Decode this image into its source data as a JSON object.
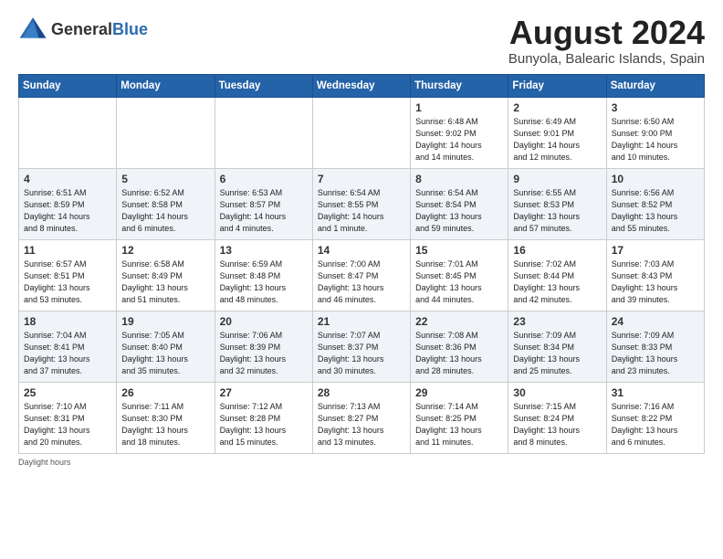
{
  "header": {
    "logo_general": "General",
    "logo_blue": "Blue",
    "month_year": "August 2024",
    "location": "Bunyola, Balearic Islands, Spain"
  },
  "columns": [
    "Sunday",
    "Monday",
    "Tuesday",
    "Wednesday",
    "Thursday",
    "Friday",
    "Saturday"
  ],
  "weeks": [
    [
      {
        "day": "",
        "info": ""
      },
      {
        "day": "",
        "info": ""
      },
      {
        "day": "",
        "info": ""
      },
      {
        "day": "",
        "info": ""
      },
      {
        "day": "1",
        "info": "Sunrise: 6:48 AM\nSunset: 9:02 PM\nDaylight: 14 hours\nand 14 minutes."
      },
      {
        "day": "2",
        "info": "Sunrise: 6:49 AM\nSunset: 9:01 PM\nDaylight: 14 hours\nand 12 minutes."
      },
      {
        "day": "3",
        "info": "Sunrise: 6:50 AM\nSunset: 9:00 PM\nDaylight: 14 hours\nand 10 minutes."
      }
    ],
    [
      {
        "day": "4",
        "info": "Sunrise: 6:51 AM\nSunset: 8:59 PM\nDaylight: 14 hours\nand 8 minutes."
      },
      {
        "day": "5",
        "info": "Sunrise: 6:52 AM\nSunset: 8:58 PM\nDaylight: 14 hours\nand 6 minutes."
      },
      {
        "day": "6",
        "info": "Sunrise: 6:53 AM\nSunset: 8:57 PM\nDaylight: 14 hours\nand 4 minutes."
      },
      {
        "day": "7",
        "info": "Sunrise: 6:54 AM\nSunset: 8:55 PM\nDaylight: 14 hours\nand 1 minute."
      },
      {
        "day": "8",
        "info": "Sunrise: 6:54 AM\nSunset: 8:54 PM\nDaylight: 13 hours\nand 59 minutes."
      },
      {
        "day": "9",
        "info": "Sunrise: 6:55 AM\nSunset: 8:53 PM\nDaylight: 13 hours\nand 57 minutes."
      },
      {
        "day": "10",
        "info": "Sunrise: 6:56 AM\nSunset: 8:52 PM\nDaylight: 13 hours\nand 55 minutes."
      }
    ],
    [
      {
        "day": "11",
        "info": "Sunrise: 6:57 AM\nSunset: 8:51 PM\nDaylight: 13 hours\nand 53 minutes."
      },
      {
        "day": "12",
        "info": "Sunrise: 6:58 AM\nSunset: 8:49 PM\nDaylight: 13 hours\nand 51 minutes."
      },
      {
        "day": "13",
        "info": "Sunrise: 6:59 AM\nSunset: 8:48 PM\nDaylight: 13 hours\nand 48 minutes."
      },
      {
        "day": "14",
        "info": "Sunrise: 7:00 AM\nSunset: 8:47 PM\nDaylight: 13 hours\nand 46 minutes."
      },
      {
        "day": "15",
        "info": "Sunrise: 7:01 AM\nSunset: 8:45 PM\nDaylight: 13 hours\nand 44 minutes."
      },
      {
        "day": "16",
        "info": "Sunrise: 7:02 AM\nSunset: 8:44 PM\nDaylight: 13 hours\nand 42 minutes."
      },
      {
        "day": "17",
        "info": "Sunrise: 7:03 AM\nSunset: 8:43 PM\nDaylight: 13 hours\nand 39 minutes."
      }
    ],
    [
      {
        "day": "18",
        "info": "Sunrise: 7:04 AM\nSunset: 8:41 PM\nDaylight: 13 hours\nand 37 minutes."
      },
      {
        "day": "19",
        "info": "Sunrise: 7:05 AM\nSunset: 8:40 PM\nDaylight: 13 hours\nand 35 minutes."
      },
      {
        "day": "20",
        "info": "Sunrise: 7:06 AM\nSunset: 8:39 PM\nDaylight: 13 hours\nand 32 minutes."
      },
      {
        "day": "21",
        "info": "Sunrise: 7:07 AM\nSunset: 8:37 PM\nDaylight: 13 hours\nand 30 minutes."
      },
      {
        "day": "22",
        "info": "Sunrise: 7:08 AM\nSunset: 8:36 PM\nDaylight: 13 hours\nand 28 minutes."
      },
      {
        "day": "23",
        "info": "Sunrise: 7:09 AM\nSunset: 8:34 PM\nDaylight: 13 hours\nand 25 minutes."
      },
      {
        "day": "24",
        "info": "Sunrise: 7:09 AM\nSunset: 8:33 PM\nDaylight: 13 hours\nand 23 minutes."
      }
    ],
    [
      {
        "day": "25",
        "info": "Sunrise: 7:10 AM\nSunset: 8:31 PM\nDaylight: 13 hours\nand 20 minutes."
      },
      {
        "day": "26",
        "info": "Sunrise: 7:11 AM\nSunset: 8:30 PM\nDaylight: 13 hours\nand 18 minutes."
      },
      {
        "day": "27",
        "info": "Sunrise: 7:12 AM\nSunset: 8:28 PM\nDaylight: 13 hours\nand 15 minutes."
      },
      {
        "day": "28",
        "info": "Sunrise: 7:13 AM\nSunset: 8:27 PM\nDaylight: 13 hours\nand 13 minutes."
      },
      {
        "day": "29",
        "info": "Sunrise: 7:14 AM\nSunset: 8:25 PM\nDaylight: 13 hours\nand 11 minutes."
      },
      {
        "day": "30",
        "info": "Sunrise: 7:15 AM\nSunset: 8:24 PM\nDaylight: 13 hours\nand 8 minutes."
      },
      {
        "day": "31",
        "info": "Sunrise: 7:16 AM\nSunset: 8:22 PM\nDaylight: 13 hours\nand 6 minutes."
      }
    ]
  ],
  "footer": {
    "note": "Daylight hours"
  }
}
